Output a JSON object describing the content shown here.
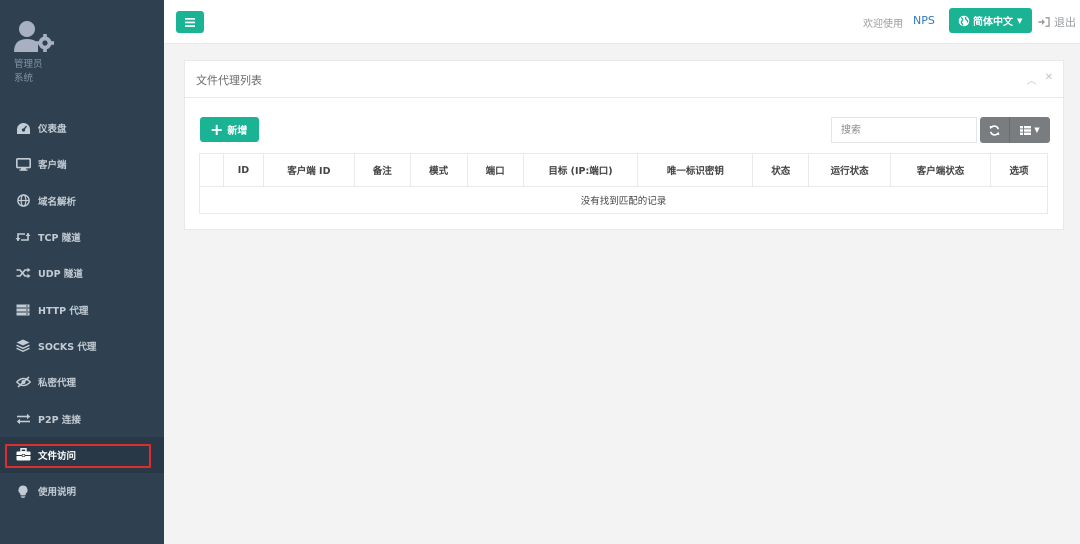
{
  "sidebar": {
    "role_line1": "管理员",
    "role_line2": "系统",
    "items": [
      {
        "label": "仪表盘",
        "icon": "dashboard-icon"
      },
      {
        "label": "客户端",
        "icon": "desktop-icon"
      },
      {
        "label": "域名解析",
        "icon": "globe-icon"
      },
      {
        "label": "TCP 隧道",
        "icon": "retweet-icon"
      },
      {
        "label": "UDP 隧道",
        "icon": "random-icon"
      },
      {
        "label": "HTTP 代理",
        "icon": "server-icon"
      },
      {
        "label": "SOCKS 代理",
        "icon": "layers-icon"
      },
      {
        "label": "私密代理",
        "icon": "eye-slash-icon"
      },
      {
        "label": "P2P 连接",
        "icon": "exchange-icon"
      },
      {
        "label": "文件访问",
        "icon": "briefcase-icon",
        "active": true
      },
      {
        "label": "使用说明",
        "icon": "lightbulb-icon"
      }
    ]
  },
  "topbar": {
    "welcome": "欢迎使用",
    "brand": "NPS",
    "language": "简体中文",
    "logout": "退出"
  },
  "panel": {
    "title": "文件代理列表",
    "add_label": "新增",
    "search_placeholder": "搜索"
  },
  "table": {
    "headers": [
      "",
      "ID",
      "客户端 ID",
      "备注",
      "模式",
      "端口",
      "目标 (IP:端口)",
      "唯一标识密钥",
      "状态",
      "运行状态",
      "客户端状态",
      "选项"
    ],
    "empty_message": "没有找到匹配的记录"
  },
  "colors": {
    "sidebar_bg": "#2f4050",
    "accent": "#1ab394",
    "highlight": "#e02c2c",
    "link": "#337ab7"
  }
}
